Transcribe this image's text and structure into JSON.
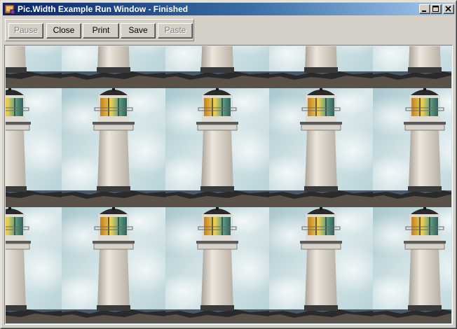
{
  "window": {
    "title": "Pic.Width Example Run Window - Finished",
    "app_icon": "run-window-icon",
    "caption_buttons": [
      "minimize-icon",
      "maximize-icon",
      "close-icon"
    ]
  },
  "toolbar": {
    "buttons": [
      {
        "label": "Pause",
        "enabled": false
      },
      {
        "label": "Close",
        "enabled": true
      },
      {
        "label": "Print",
        "enabled": true
      },
      {
        "label": "Save",
        "enabled": true
      },
      {
        "label": "Paste",
        "enabled": false
      }
    ]
  },
  "picture": {
    "subject": "lighthouse",
    "sky_color": "#bcd6dc",
    "tower_color": "#dcd6cc",
    "rock_color": "#2a2a2a",
    "sea_color": "#4a5a6a",
    "lamp_color": "#d8b030"
  }
}
